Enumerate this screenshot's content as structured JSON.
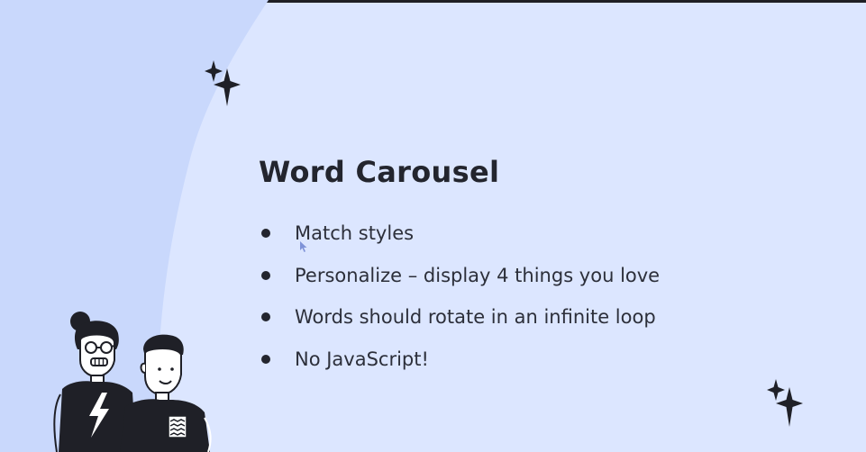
{
  "slide": {
    "title": "Word Carousel",
    "bullets": [
      "Match styles",
      "Personalize – display 4 things you love",
      "Words should rotate in an infinite loop",
      "No JavaScript!"
    ]
  },
  "colors": {
    "background": "#dce6ff",
    "left_panel": "#c9d8fc",
    "text_dark": "#23252e",
    "cursor": "#7f93d8"
  },
  "icons": [
    "sparkle-icon",
    "mouse-cursor-icon",
    "people-illustration"
  ]
}
